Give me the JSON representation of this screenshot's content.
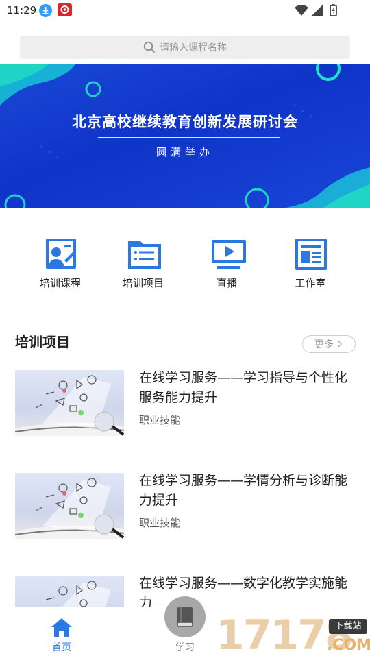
{
  "status_bar": {
    "time": "11:29"
  },
  "search": {
    "placeholder": "请输入课程名称"
  },
  "banner": {
    "title": "北京高校继续教育创新发展研讨会",
    "subtitle": "圆满举办"
  },
  "quick_nav": [
    {
      "label": "培训课程",
      "icon": "course-icon"
    },
    {
      "label": "培训项目",
      "icon": "folder-list-icon"
    },
    {
      "label": "直播",
      "icon": "play-screen-icon"
    },
    {
      "label": "工作室",
      "icon": "studio-icon"
    }
  ],
  "section": {
    "title": "培训项目",
    "more_label": "更多"
  },
  "courses": [
    {
      "title": "在线学习服务——学习指导与个性化服务能力提升",
      "tag": "职业技能"
    },
    {
      "title": "在线学习服务——学情分析与诊断能力提升",
      "tag": "职业技能"
    },
    {
      "title": "在线学习服务——数字化教学实施能力",
      "tag": ""
    }
  ],
  "tab_bar": {
    "home_label": "首页",
    "study_label": "学习"
  },
  "watermark": {
    "number": "17178",
    "tag": "下载站",
    "suffix": ".COM"
  },
  "colors": {
    "accent": "#2a78e4",
    "banner": "#1238cc"
  }
}
